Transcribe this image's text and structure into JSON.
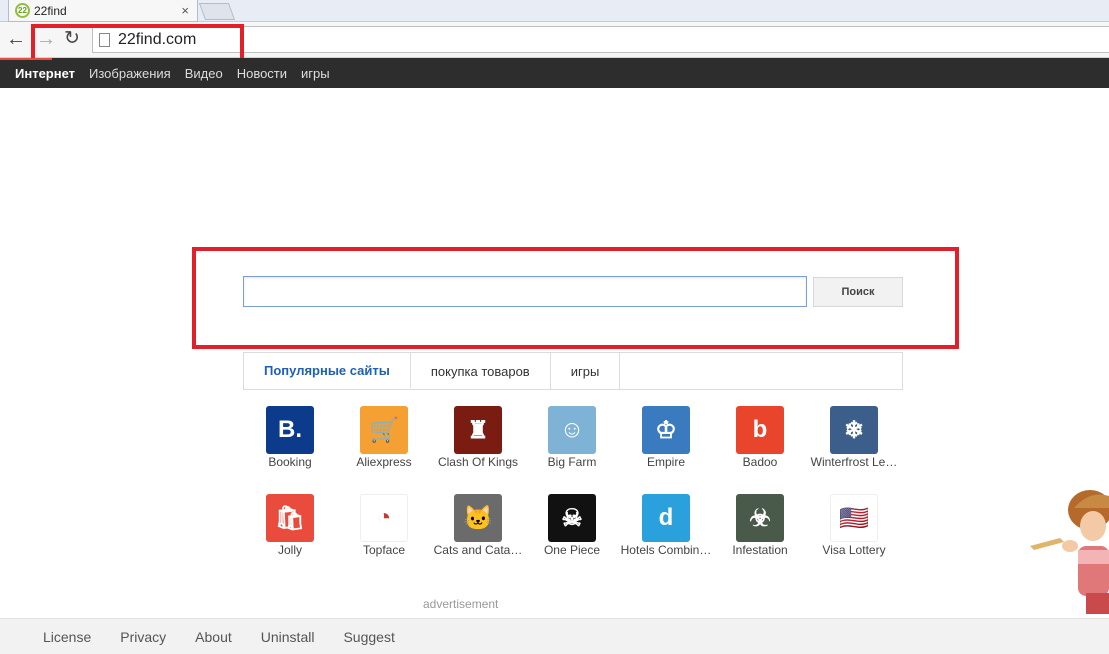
{
  "browser": {
    "tab_title": "22find",
    "tab_icon_text": "22",
    "url": "22find.com"
  },
  "nav": {
    "items": [
      "Интернет",
      "Изображения",
      "Видео",
      "Новости",
      "игры"
    ]
  },
  "search": {
    "button_label": "Поиск",
    "value": ""
  },
  "content_tabs": [
    "Популярные сайты",
    "покупка товаров",
    "игры"
  ],
  "tiles": [
    {
      "label": "Booking",
      "color": "#0d3b8c",
      "glyph": "B."
    },
    {
      "label": "Aliexpress",
      "color": "#f5a033",
      "glyph": "🛒"
    },
    {
      "label": "Clash Of Kings",
      "color": "#7a1c12",
      "glyph": "♜"
    },
    {
      "label": "Big Farm",
      "color": "#7fb3d6",
      "glyph": "☺"
    },
    {
      "label": "Empire",
      "color": "#3a7bbf",
      "glyph": "♔"
    },
    {
      "label": "Badoo",
      "color": "#e8452c",
      "glyph": "b"
    },
    {
      "label": "Winterfrost Le…",
      "color": "#3b5f8a",
      "glyph": "❄"
    },
    {
      "label": "Jolly",
      "color": "#e94b3c",
      "glyph": "🛍"
    },
    {
      "label": "Topface",
      "color": "#ffffff",
      "glyph": "◔"
    },
    {
      "label": "Cats and Cata…",
      "color": "#6b6b6b",
      "glyph": "🐱"
    },
    {
      "label": "One Piece",
      "color": "#111111",
      "glyph": "☠"
    },
    {
      "label": "Hotels Combin…",
      "color": "#2aa1dc",
      "glyph": "d"
    },
    {
      "label": "Infestation",
      "color": "#4a5a4a",
      "glyph": "☣"
    },
    {
      "label": "Visa Lottery",
      "color": "#ffffff",
      "glyph": "🇺🇸"
    }
  ],
  "advertisement_label": "advertisement",
  "footer": {
    "links": [
      "License",
      "Privacy",
      "About",
      "Uninstall",
      "Suggest"
    ]
  }
}
